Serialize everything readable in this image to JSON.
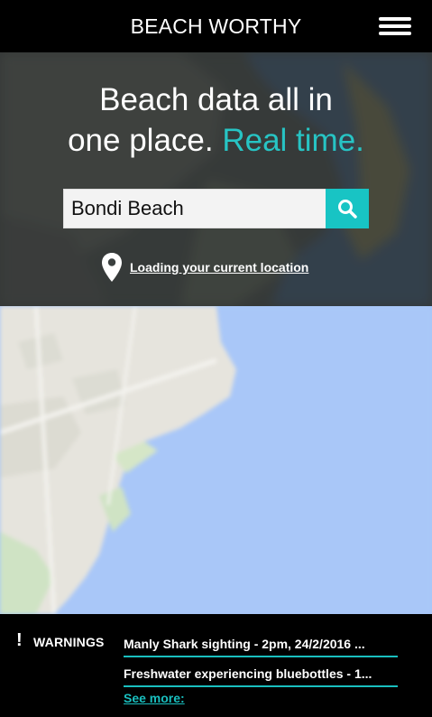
{
  "header": {
    "title": "BEACH WORTHY",
    "menu_icon": "hamburger-menu-icon"
  },
  "hero": {
    "headline_line1": "Beach data all in",
    "headline_plain": "one place. ",
    "headline_accent": "Real time.",
    "accent_color": "#27c4c4"
  },
  "search": {
    "value": "Bondi Beach",
    "button_icon": "search-icon",
    "button_color": "#18c4c4"
  },
  "location": {
    "icon": "map-pin-icon",
    "label": "Loading your current location"
  },
  "map": {
    "water_color": "#a8c6f7",
    "land_color": "#e8e6df"
  },
  "warnings": {
    "icon": "!",
    "title": "WARNINGS",
    "items": [
      "Manly Shark sighting  - 2pm, 24/2/2016 ...",
      "Freshwater experiencing bluebottles - 1..."
    ],
    "see_more": "See more:"
  }
}
